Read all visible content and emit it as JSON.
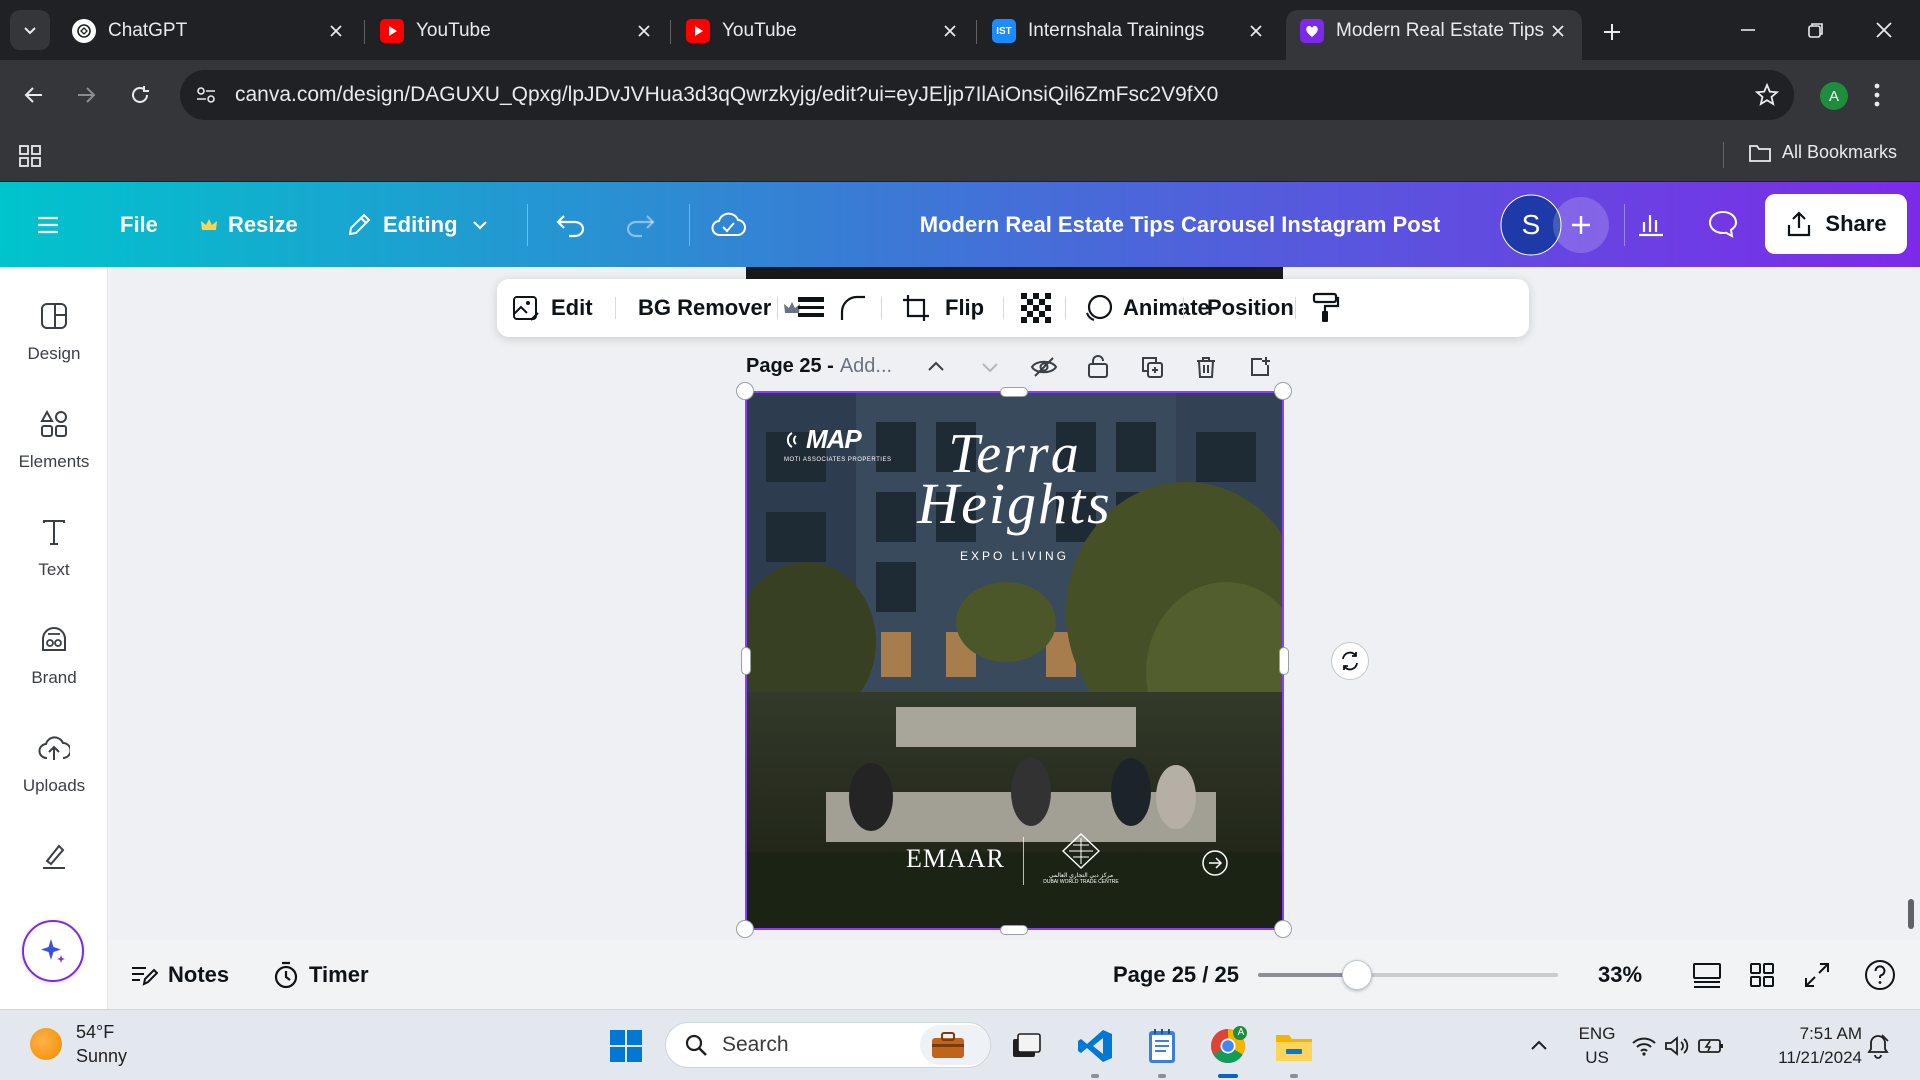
{
  "browser": {
    "tabs": [
      {
        "label": "ChatGPT",
        "icon": "chatgpt-icon"
      },
      {
        "label": "YouTube",
        "icon": "youtube-icon"
      },
      {
        "label": "YouTube",
        "icon": "youtube-icon"
      },
      {
        "label": "Internshala Trainings",
        "icon": "internshala-icon",
        "badge": "IST"
      },
      {
        "label": "Modern Real Estate Tips C",
        "icon": "canva-icon",
        "active": true
      }
    ],
    "url": "canva.com/design/DAGUXU_Qpxg/lpJDvJVHua3d3qQwrzkyjg/edit?ui=eyJEljp7IlAiOnsiQil6ZmFsc2V9fX0",
    "profile_initial": "A",
    "bookmarks_label": "All Bookmarks"
  },
  "header": {
    "file": "File",
    "resize": "Resize",
    "editing": "Editing",
    "doc_title": "Modern Real Estate Tips Carousel Instagram Post",
    "avatar_initial": "S",
    "share": "Share",
    "gradient": [
      "#00c4cc",
      "#3a7bd5",
      "#7d2ae8"
    ]
  },
  "sidebar": {
    "items": [
      {
        "label": "Design",
        "icon": "design-icon"
      },
      {
        "label": "Elements",
        "icon": "elements-icon"
      },
      {
        "label": "Text",
        "icon": "text-icon"
      },
      {
        "label": "Brand",
        "icon": "brand-icon"
      },
      {
        "label": "Uploads",
        "icon": "uploads-icon"
      },
      {
        "label": "",
        "icon": "draw-icon"
      }
    ]
  },
  "toolbar": {
    "edit": "Edit",
    "bg_remover": "BG Remover",
    "flip": "Flip",
    "animate": "Animate",
    "position": "Position"
  },
  "page": {
    "number_label": "Page 25 -",
    "add_title": "Add...",
    "design": {
      "logo": "MAP",
      "logo_sub": "MOTI ASSOCIATES PROPERTIES",
      "title_line1": "Terra",
      "title_line2": "Heights",
      "subtitle": "EXPO LIVING",
      "developer": "EMAAR",
      "partner_arabic": "مركز دبي التجاري العالمي",
      "partner": "DUBAI WORLD TRADE CENTRE"
    }
  },
  "bottombar": {
    "notes": "Notes",
    "timer": "Timer",
    "page_indicator": "Page 25 / 25",
    "zoom_label": "33%",
    "zoom_fraction": 0.33
  },
  "taskbar": {
    "weather_temp": "54°F",
    "weather_desc": "Sunny",
    "search_placeholder": "Search",
    "lang_top": "ENG",
    "lang_bottom": "US",
    "time": "7:51 AM",
    "date": "11/21/2024",
    "accent": "#0067c0"
  }
}
